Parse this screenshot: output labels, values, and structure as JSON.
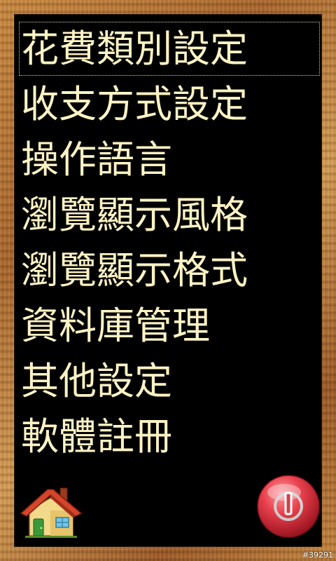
{
  "menu": {
    "items": [
      {
        "label": "花費類別設定"
      },
      {
        "label": "收支方式設定"
      },
      {
        "label": "操作語言"
      },
      {
        "label": "瀏覽顯示風格"
      },
      {
        "label": "瀏覽顯示格式"
      },
      {
        "label": "資料庫管理"
      },
      {
        "label": "其他設定"
      },
      {
        "label": "軟體註冊"
      }
    ]
  },
  "footer": {
    "watermark": "#39291"
  },
  "colors": {
    "text": "#fff3c4",
    "board": "#000000",
    "frame": "#b87733",
    "power_red": "#e0404a"
  },
  "icons": {
    "home": "house-icon",
    "power": "power-icon"
  }
}
